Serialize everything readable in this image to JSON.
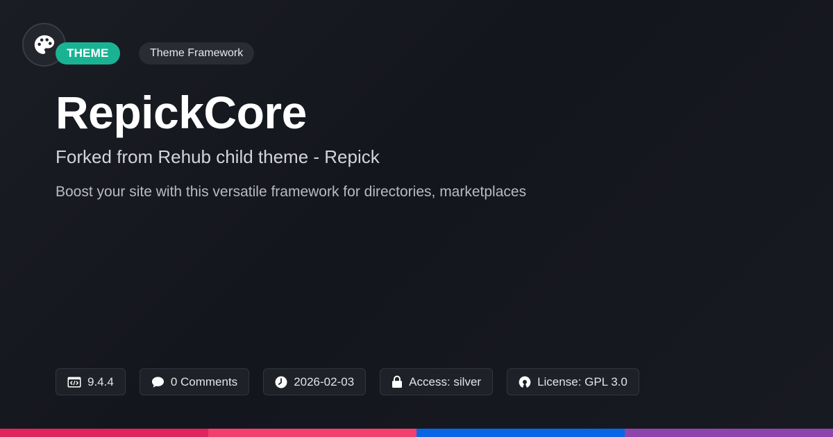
{
  "header": {
    "logo_icon": "palette-icon",
    "type_badge": "THEME",
    "category": "Theme Framework"
  },
  "main": {
    "title": "RepickCore",
    "subtitle": "Forked from Rehub child theme - Repick",
    "description": "Boost your site with this versatile framework for directories, marketplaces"
  },
  "meta": {
    "version": {
      "icon": "code-icon",
      "text": "9.4.4"
    },
    "comments": {
      "icon": "comment-icon",
      "text": "0 Comments"
    },
    "date": {
      "icon": "clock-icon",
      "text": "2026-02-03"
    },
    "access": {
      "icon": "lock-icon",
      "text": "Access: silver"
    },
    "license": {
      "icon": "open-source-icon",
      "text": "License: GPL 3.0"
    }
  },
  "colors": {
    "accent": "#19b394",
    "stripe": [
      "#e0245e",
      "#f43f6e",
      "#0866e6",
      "#8e44ad"
    ]
  }
}
